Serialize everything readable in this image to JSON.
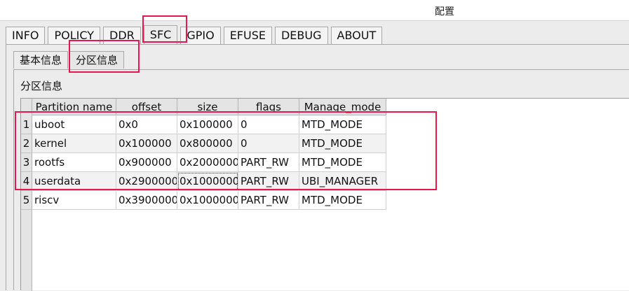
{
  "window": {
    "title": "配置"
  },
  "main_tabs": [
    {
      "label": "INFO"
    },
    {
      "label": "POLICY"
    },
    {
      "label": "DDR"
    },
    {
      "label": "SFC",
      "active": true
    },
    {
      "label": "GPIO"
    },
    {
      "label": "EFUSE"
    },
    {
      "label": "DEBUG"
    },
    {
      "label": "ABOUT"
    }
  ],
  "sub_tabs": [
    {
      "label": "基本信息"
    },
    {
      "label": "分区信息",
      "active": true
    }
  ],
  "section": {
    "label": "分区信息"
  },
  "table": {
    "columns": [
      "Partition name",
      "offset",
      "size",
      "flags",
      "Manage_mode"
    ],
    "rows": [
      {
        "num": "1",
        "cells": [
          "uboot",
          "0x0",
          "0x100000",
          "0",
          "MTD_MODE"
        ]
      },
      {
        "num": "2",
        "cells": [
          "kernel",
          "0x100000",
          "0x800000",
          "0",
          "MTD_MODE"
        ]
      },
      {
        "num": "3",
        "cells": [
          "rootfs",
          "0x900000",
          "0x2000000",
          "PART_RW",
          "MTD_MODE"
        ]
      },
      {
        "num": "4",
        "cells": [
          "userdata",
          "0x2900000",
          "0x1000000",
          "PART_RW",
          "UBI_MANAGER"
        ]
      },
      {
        "num": "5",
        "cells": [
          "riscv",
          "0x3900000",
          "0x1000000",
          "PART_RW",
          "MTD_MODE"
        ]
      }
    ]
  },
  "colors": {
    "highlight": "#e8164f"
  }
}
